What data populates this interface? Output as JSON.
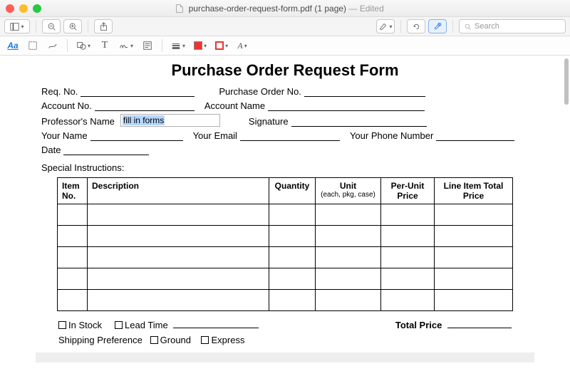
{
  "window": {
    "filename": "purchase-order-request-form.pdf (1 page)",
    "edited": "Edited",
    "search_placeholder": "Search"
  },
  "form": {
    "title": "Purchase Order Request Form",
    "labels": {
      "req_no": "Req. No.",
      "po_no": "Purchase Order No.",
      "account_no": "Account No.",
      "account_name": "Account Name",
      "professor": "Professor's Name",
      "signature": "Signature",
      "your_name": "Your Name",
      "your_email": "Your Email",
      "your_phone": "Your Phone Number",
      "date": "Date",
      "special": "Special Instructions:",
      "in_stock": "In Stock",
      "lead_time": "Lead Time",
      "shipping_pref": "Shipping Preference",
      "ground": "Ground",
      "express": "Express",
      "total_price": "Total Price"
    },
    "professor_value": "fill in forms",
    "table": {
      "headers": {
        "item_no": "Item No.",
        "description": "Description",
        "quantity": "Quantity",
        "unit": "Unit",
        "unit_sub": "(each, pkg, case)",
        "per_unit": "Per-Unit Price",
        "line_total": "Line Item Total Price"
      }
    }
  },
  "toolbar2": {
    "aa": "Aa"
  }
}
